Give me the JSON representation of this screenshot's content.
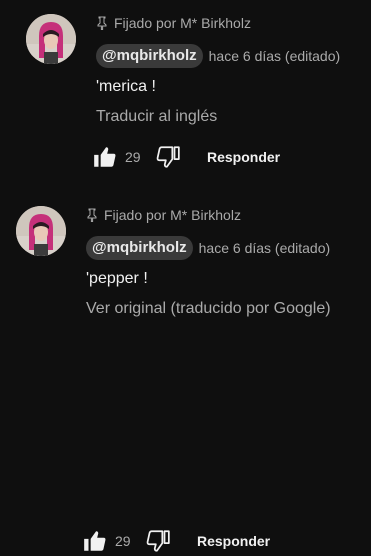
{
  "comments": [
    {
      "pinned_label": "Fijado por M* Birkholz",
      "author_handle": "@mqbirkholz",
      "timestamp": "hace 6 días (editado)",
      "text": "'merica !",
      "translate_link": "Traducir al inglés",
      "like_count": "29",
      "reply_label": "Responder"
    },
    {
      "pinned_label": "Fijado por M* Birkholz",
      "author_handle": "@mqbirkholz",
      "timestamp": "hace 6 días (editado)",
      "text": "'pepper !",
      "translate_link": "Ver original (traducido por Google)",
      "like_count": "29",
      "reply_label": "Responder"
    }
  ],
  "icons": {
    "pin": "pin-icon",
    "like": "thumbs-up-icon",
    "dislike": "thumbs-down-icon"
  },
  "colors": {
    "background": "#0f0f0f",
    "handle_chip": "#3a3a3a",
    "secondary_text": "#aaaaaa",
    "primary_text": "#f1f1f1"
  }
}
